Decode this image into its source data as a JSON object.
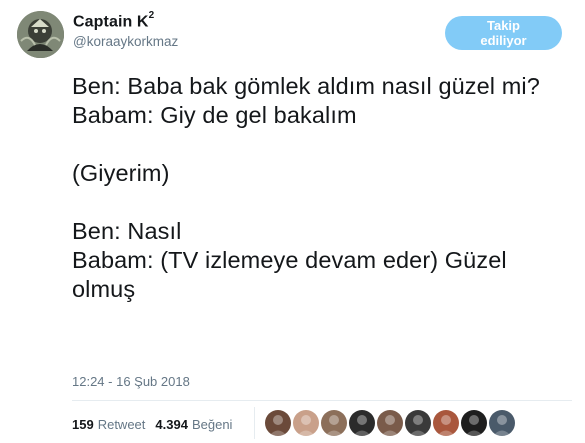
{
  "user": {
    "display_name": "Captain K",
    "superscript": "2",
    "handle": "@koraaykorkmaz"
  },
  "follow_button": {
    "label": "Takip ediliyor"
  },
  "tweet": {
    "text": "Ben: Baba bak gömlek aldım nasıl güzel mi?\nBabam: Giy de gel bakalım\n\n(Giyerim)\n\nBen: Nasıl\nBabam: (TV izlemeye devam eder) Güzel olmuş",
    "timestamp": "12:24 - 16 Şub 2018"
  },
  "stats": {
    "retweets_count": "159",
    "retweets_label": "Retweet",
    "likes_count": "4.394",
    "likes_label": "Beğeni"
  },
  "likers": [
    {
      "icon": "liker-avatar-1",
      "color": "#6b4a3a"
    },
    {
      "icon": "liker-avatar-2",
      "color": "#c9a08a"
    },
    {
      "icon": "liker-avatar-3",
      "color": "#8c6f5a"
    },
    {
      "icon": "liker-avatar-4",
      "color": "#2b2b2b"
    },
    {
      "icon": "liker-avatar-5",
      "color": "#7a5b4a"
    },
    {
      "icon": "liker-avatar-6",
      "color": "#3a3a3a"
    },
    {
      "icon": "liker-avatar-7",
      "color": "#a9573d"
    },
    {
      "icon": "liker-avatar-8",
      "color": "#1e1e1e"
    },
    {
      "icon": "liker-avatar-9",
      "color": "#4a5a6a"
    }
  ],
  "colors": {
    "brand": "#1da1f2",
    "text": "#14171a",
    "muted": "#657786",
    "divider": "#e6ecf0"
  }
}
